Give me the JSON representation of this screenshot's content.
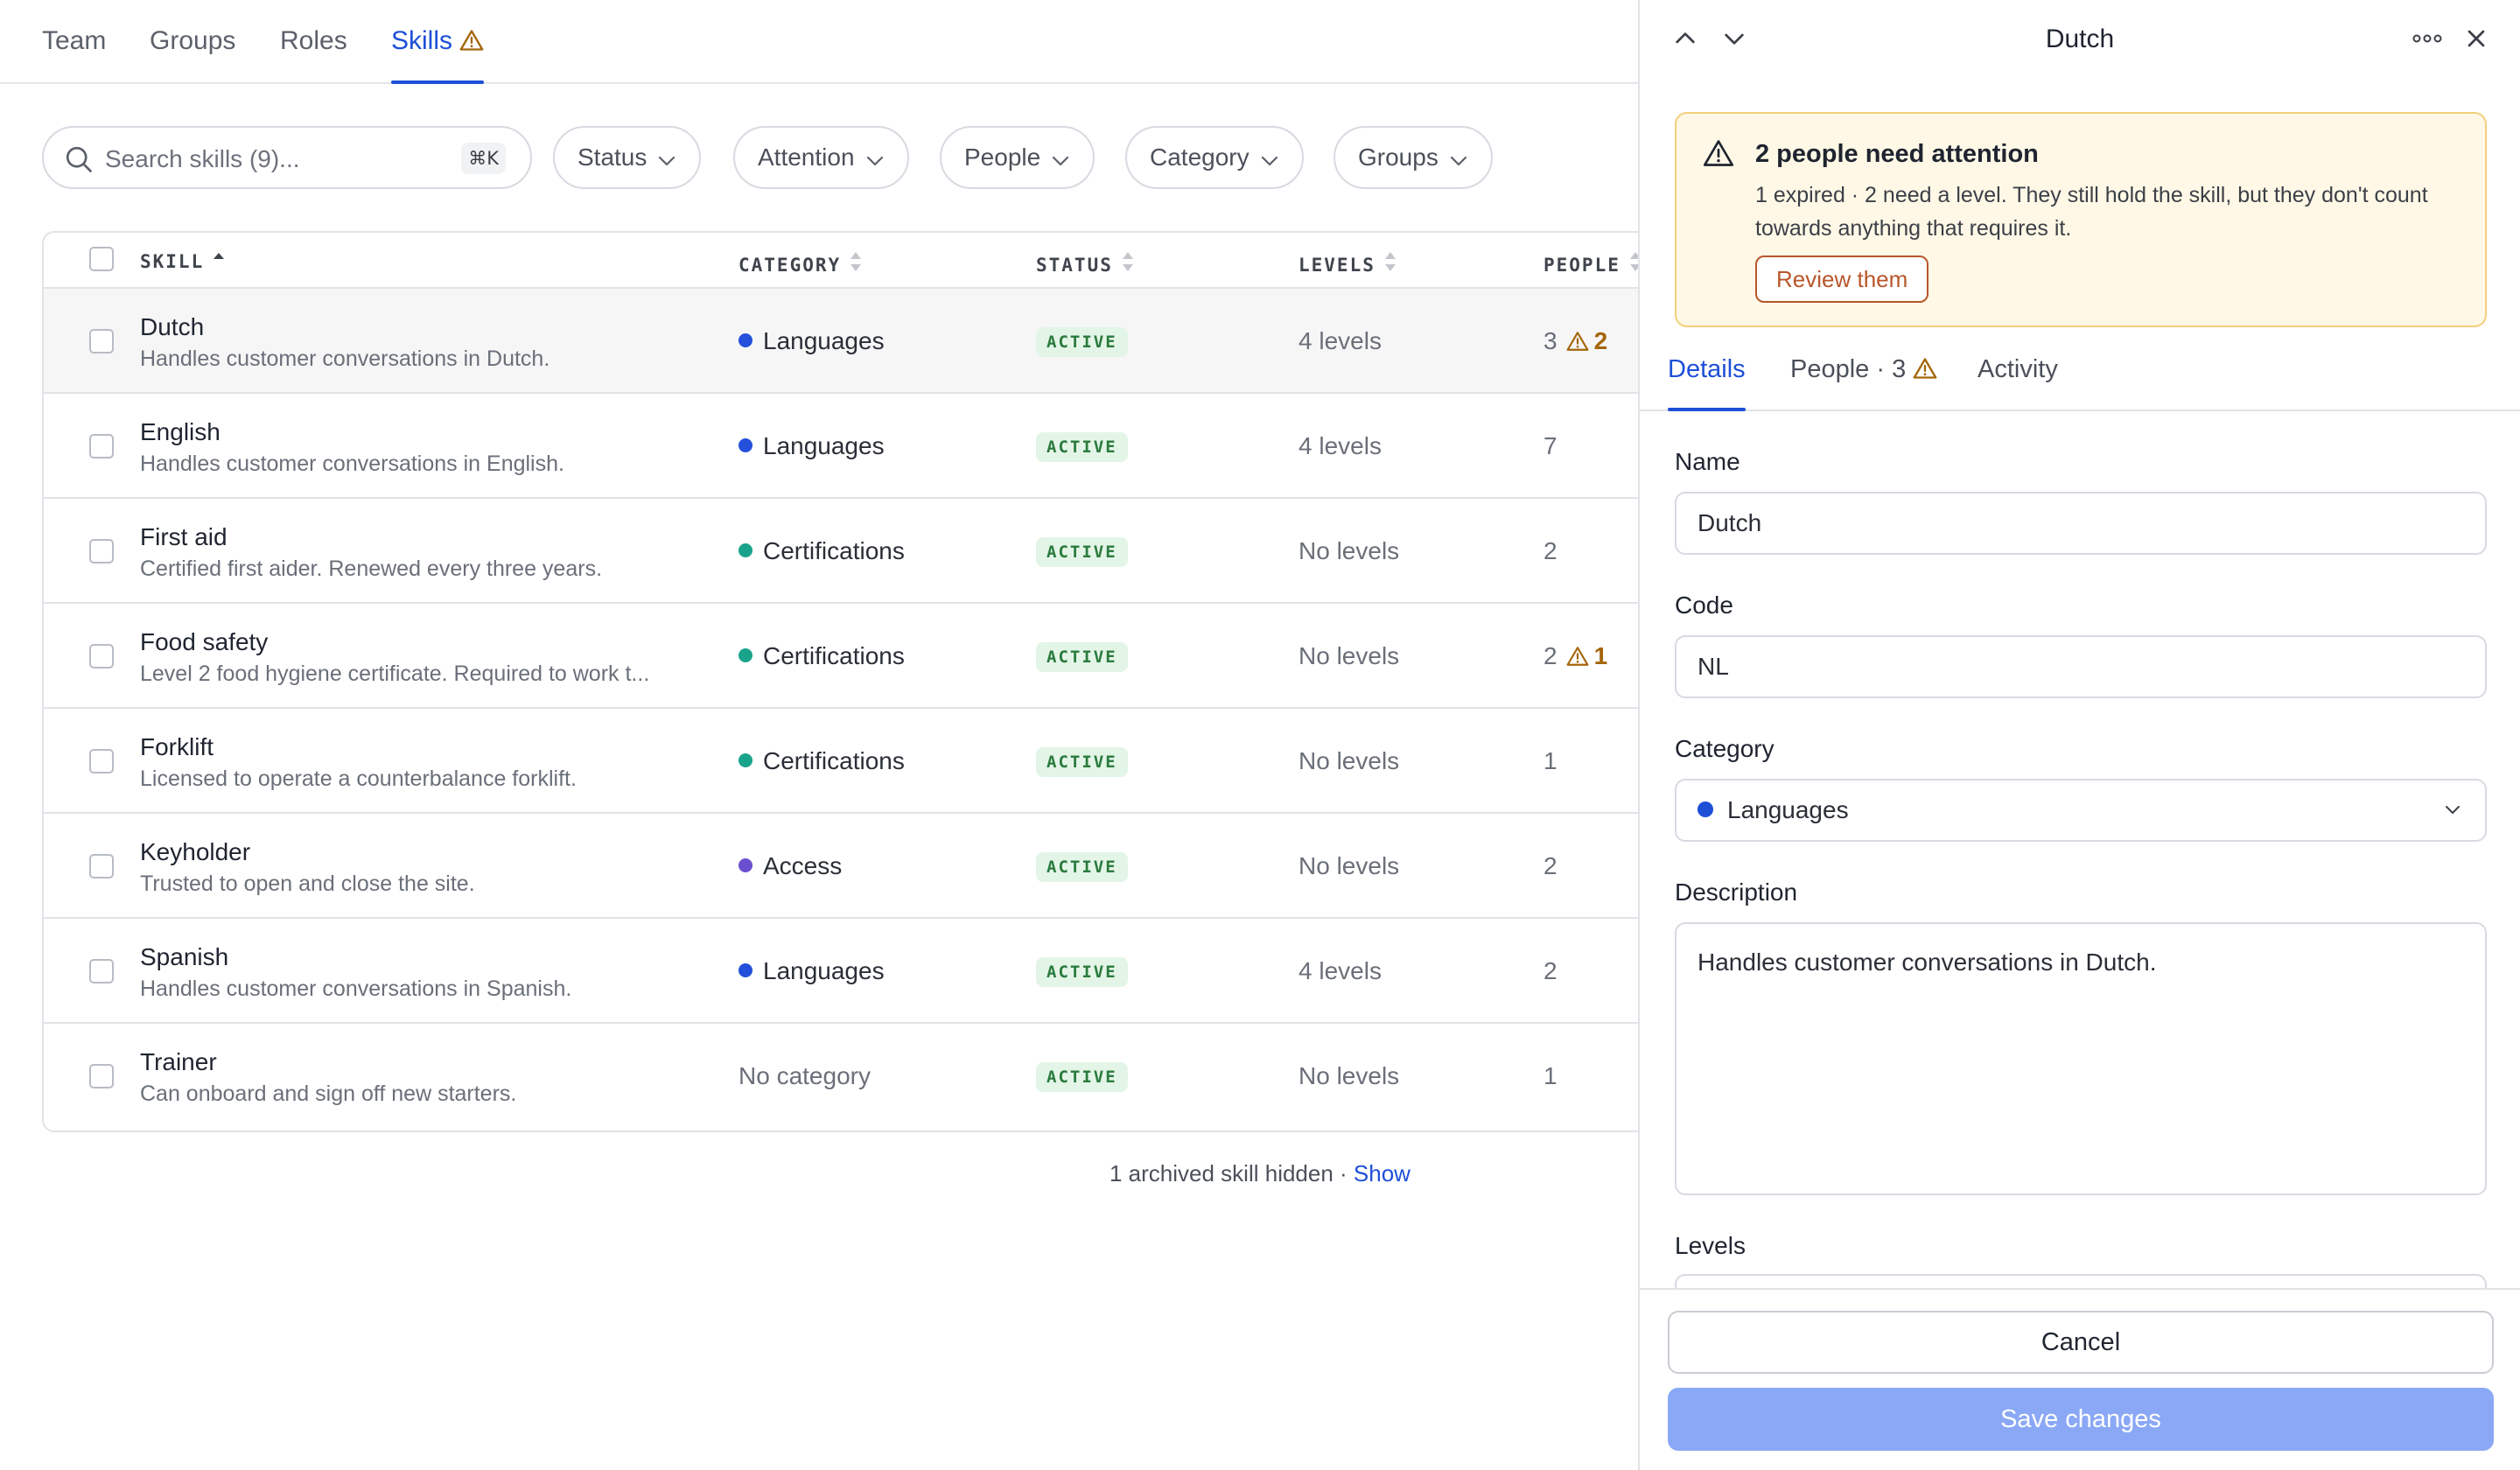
{
  "nav": {
    "tabs": [
      {
        "label": "Team"
      },
      {
        "label": "Groups"
      },
      {
        "label": "Roles"
      },
      {
        "label": "Skills",
        "active": true,
        "icon": "warning-icon"
      }
    ]
  },
  "filters": {
    "search_placeholder": "Search skills (9)...",
    "search_shortcut": "⌘K",
    "chips": [
      {
        "label": "Status"
      },
      {
        "label": "Attention"
      },
      {
        "label": "People"
      },
      {
        "label": "Category"
      },
      {
        "label": "Groups"
      }
    ]
  },
  "table": {
    "columns": {
      "skill": "SKILL",
      "category": "CATEGORY",
      "status": "STATUS",
      "levels": "LEVELS",
      "people": "PEOPLE"
    },
    "rows": [
      {
        "name": "Dutch",
        "desc": "Handles customer conversations in Dutch.",
        "category": "Languages",
        "status": "ACTIVE",
        "levels": "4 levels",
        "people": "3",
        "attention": "2"
      },
      {
        "name": "English",
        "desc": "Handles customer conversations in English.",
        "category": "Languages",
        "status": "ACTIVE",
        "levels": "4 levels",
        "people": "7",
        "attention": ""
      },
      {
        "name": "First aid",
        "desc": "Certified first aider. Renewed every three years.",
        "category": "Certifications",
        "status": "ACTIVE",
        "levels": "No levels",
        "people": "2",
        "attention": ""
      },
      {
        "name": "Food safety",
        "desc": "Level 2 food hygiene certificate. Required to work t...",
        "category": "Certifications",
        "status": "ACTIVE",
        "levels": "No levels",
        "people": "2",
        "attention": "1"
      },
      {
        "name": "Forklift",
        "desc": "Licensed to operate a counterbalance forklift.",
        "category": "Certifications",
        "status": "ACTIVE",
        "levels": "No levels",
        "people": "1",
        "attention": ""
      },
      {
        "name": "Keyholder",
        "desc": "Trusted to open and close the site.",
        "category": "Access",
        "status": "ACTIVE",
        "levels": "No levels",
        "people": "2",
        "attention": ""
      },
      {
        "name": "Spanish",
        "desc": "Handles customer conversations in Spanish.",
        "category": "Languages",
        "status": "ACTIVE",
        "levels": "4 levels",
        "people": "2",
        "attention": ""
      },
      {
        "name": "Trainer",
        "desc": "Can onboard and sign off new starters.",
        "category": "No category",
        "status": "ACTIVE",
        "levels": "No levels",
        "people": "1",
        "attention": ""
      }
    ]
  },
  "archived": {
    "text": "1 archived skill hidden · ",
    "link": "Show"
  },
  "colors": {
    "Languages": "#2450dc",
    "Certifications": "#1aa38b",
    "Access": "#6b4fd1",
    "accent": "#1d4fd7",
    "warning": "#a4660a"
  },
  "panel": {
    "title": "Dutch",
    "alert": {
      "title": "2 people need attention",
      "text": "1 expired · 2 need a level. They still hold the skill, but they don't count towards anything that requires it.",
      "button": "Review them"
    },
    "tabs": {
      "details": "Details",
      "people": "People · 3",
      "activity": "Activity"
    },
    "fields": {
      "name_label": "Name",
      "name_value": "Dutch",
      "code_label": "Code",
      "code_value": "NL",
      "category_label": "Category",
      "category_value": "Languages",
      "description_label": "Description",
      "description_value": "Handles customer conversations in Dutch.",
      "levels_label": "Levels"
    },
    "footer": {
      "cancel": "Cancel",
      "save": "Save changes"
    }
  }
}
